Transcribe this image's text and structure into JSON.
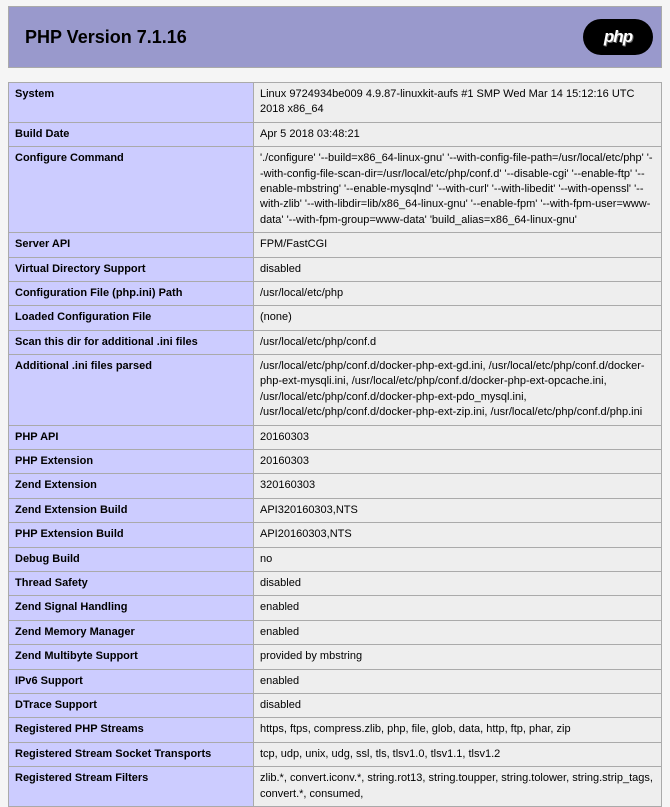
{
  "title": "PHP Version 7.1.16",
  "logo_text": "php",
  "rows": [
    {
      "k": "System",
      "v": "Linux 9724934be009 4.9.87-linuxkit-aufs #1 SMP Wed Mar 14 15:12:16 UTC 2018 x86_64"
    },
    {
      "k": "Build Date",
      "v": "Apr 5 2018 03:48:21"
    },
    {
      "k": "Configure Command",
      "v": "'./configure' '--build=x86_64-linux-gnu' '--with-config-file-path=/usr/local/etc/php' '--with-config-file-scan-dir=/usr/local/etc/php/conf.d' '--disable-cgi' '--enable-ftp' '--enable-mbstring' '--enable-mysqlnd' '--with-curl' '--with-libedit' '--with-openssl' '--with-zlib' '--with-libdir=lib/x86_64-linux-gnu' '--enable-fpm' '--with-fpm-user=www-data' '--with-fpm-group=www-data' 'build_alias=x86_64-linux-gnu'"
    },
    {
      "k": "Server API",
      "v": "FPM/FastCGI"
    },
    {
      "k": "Virtual Directory Support",
      "v": "disabled"
    },
    {
      "k": "Configuration File (php.ini) Path",
      "v": "/usr/local/etc/php"
    },
    {
      "k": "Loaded Configuration File",
      "v": "(none)"
    },
    {
      "k": "Scan this dir for additional .ini files",
      "v": "/usr/local/etc/php/conf.d"
    },
    {
      "k": "Additional .ini files parsed",
      "v": "/usr/local/etc/php/conf.d/docker-php-ext-gd.ini, /usr/local/etc/php/conf.d/docker-php-ext-mysqli.ini, /usr/local/etc/php/conf.d/docker-php-ext-opcache.ini, /usr/local/etc/php/conf.d/docker-php-ext-pdo_mysql.ini, /usr/local/etc/php/conf.d/docker-php-ext-zip.ini, /usr/local/etc/php/conf.d/php.ini"
    },
    {
      "k": "PHP API",
      "v": "20160303"
    },
    {
      "k": "PHP Extension",
      "v": "20160303"
    },
    {
      "k": "Zend Extension",
      "v": "320160303"
    },
    {
      "k": "Zend Extension Build",
      "v": "API320160303,NTS"
    },
    {
      "k": "PHP Extension Build",
      "v": "API20160303,NTS"
    },
    {
      "k": "Debug Build",
      "v": "no"
    },
    {
      "k": "Thread Safety",
      "v": "disabled"
    },
    {
      "k": "Zend Signal Handling",
      "v": "enabled"
    },
    {
      "k": "Zend Memory Manager",
      "v": "enabled"
    },
    {
      "k": "Zend Multibyte Support",
      "v": "provided by mbstring"
    },
    {
      "k": "IPv6 Support",
      "v": "enabled"
    },
    {
      "k": "DTrace Support",
      "v": "disabled"
    },
    {
      "k": "Registered PHP Streams",
      "v": "https, ftps, compress.zlib, php, file, glob, data, http, ftp, phar, zip"
    },
    {
      "k": "Registered Stream Socket Transports",
      "v": "tcp, udp, unix, udg, ssl, tls, tlsv1.0, tlsv1.1, tlsv1.2"
    },
    {
      "k": "Registered Stream Filters",
      "v": "zlib.*, convert.iconv.*, string.rot13, string.toupper, string.tolower, string.strip_tags, convert.*, consumed,"
    }
  ]
}
